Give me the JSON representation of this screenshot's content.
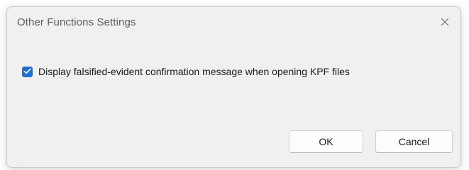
{
  "dialog": {
    "title": "Other Functions Settings",
    "close_icon": "close-icon"
  },
  "option": {
    "checked": true,
    "label": "Display falsified-evident confirmation message when opening KPF files"
  },
  "buttons": {
    "ok_label": "OK",
    "cancel_label": "Cancel"
  },
  "colors": {
    "accent": "#1f6fd0",
    "dialog_bg": "#f0f0f0",
    "button_bg": "#fdfdfd"
  }
}
